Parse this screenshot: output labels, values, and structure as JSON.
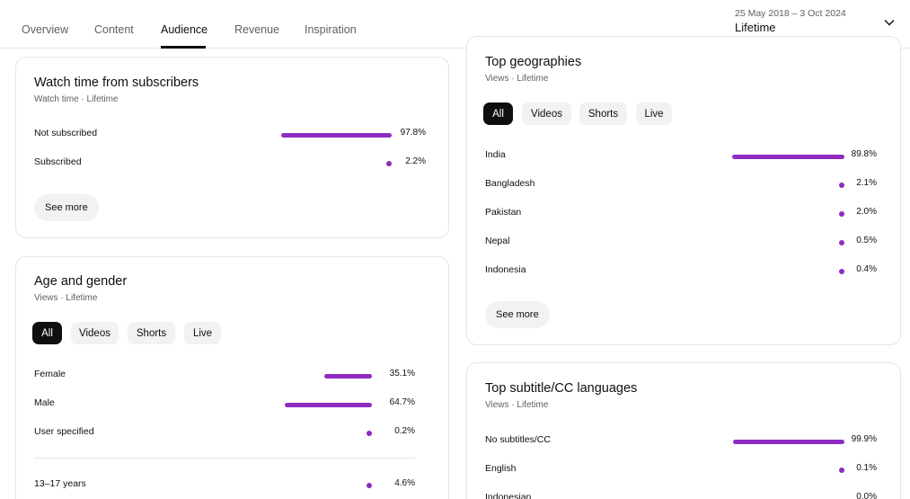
{
  "tabs": [
    {
      "label": "Overview"
    },
    {
      "label": "Content"
    },
    {
      "label": "Audience"
    },
    {
      "label": "Revenue"
    },
    {
      "label": "Inspiration"
    }
  ],
  "active_tab": "Audience",
  "date_range": {
    "dates": "25 May 2018 – 3 Oct 2024",
    "period": "Lifetime"
  },
  "watch_time": {
    "title": "Watch time from subscribers",
    "subtitle": "Watch time · Lifetime",
    "rows": [
      {
        "label": "Not subscribed",
        "value": "97.8%",
        "fraction": 0.978
      },
      {
        "label": "Subscribed",
        "value": "2.2%",
        "fraction": 0.022
      }
    ],
    "see_more": "See more"
  },
  "age_gender": {
    "title": "Age and gender",
    "subtitle": "Views · Lifetime",
    "filters": [
      "All",
      "Videos",
      "Shorts",
      "Live"
    ],
    "active_filter": "All",
    "gender_rows": [
      {
        "label": "Female",
        "value": "35.1%",
        "fraction": 0.351
      },
      {
        "label": "Male",
        "value": "64.7%",
        "fraction": 0.647
      },
      {
        "label": "User specified",
        "value": "0.2%",
        "fraction": 0.002
      }
    ],
    "age_rows": [
      {
        "label": "13–17 years",
        "value": "4.6%",
        "fraction": 0.046
      }
    ]
  },
  "geographies": {
    "title": "Top geographies",
    "subtitle": "Views · Lifetime",
    "filters": [
      "All",
      "Videos",
      "Shorts",
      "Live"
    ],
    "active_filter": "All",
    "rows": [
      {
        "label": "India",
        "value": "89.8%",
        "fraction": 0.898
      },
      {
        "label": "Bangladesh",
        "value": "2.1%",
        "fraction": 0.021
      },
      {
        "label": "Pakistan",
        "value": "2.0%",
        "fraction": 0.02
      },
      {
        "label": "Nepal",
        "value": "0.5%",
        "fraction": 0.005
      },
      {
        "label": "Indonesia",
        "value": "0.4%",
        "fraction": 0.004
      }
    ],
    "see_more": "See more"
  },
  "subtitles": {
    "title": "Top subtitle/CC languages",
    "subtitle": "Views · Lifetime",
    "rows": [
      {
        "label": "No subtitles/CC",
        "value": "99.9%",
        "fraction": 0.999
      },
      {
        "label": "English",
        "value": "0.1%",
        "fraction": 0.001
      },
      {
        "label": "Indonesian",
        "value": "0.0%",
        "fraction": 0.0
      }
    ]
  },
  "colors": {
    "bar": "#8e2bc1",
    "chip_active": "#0f0f0f",
    "chip": "#f2f2f2"
  }
}
